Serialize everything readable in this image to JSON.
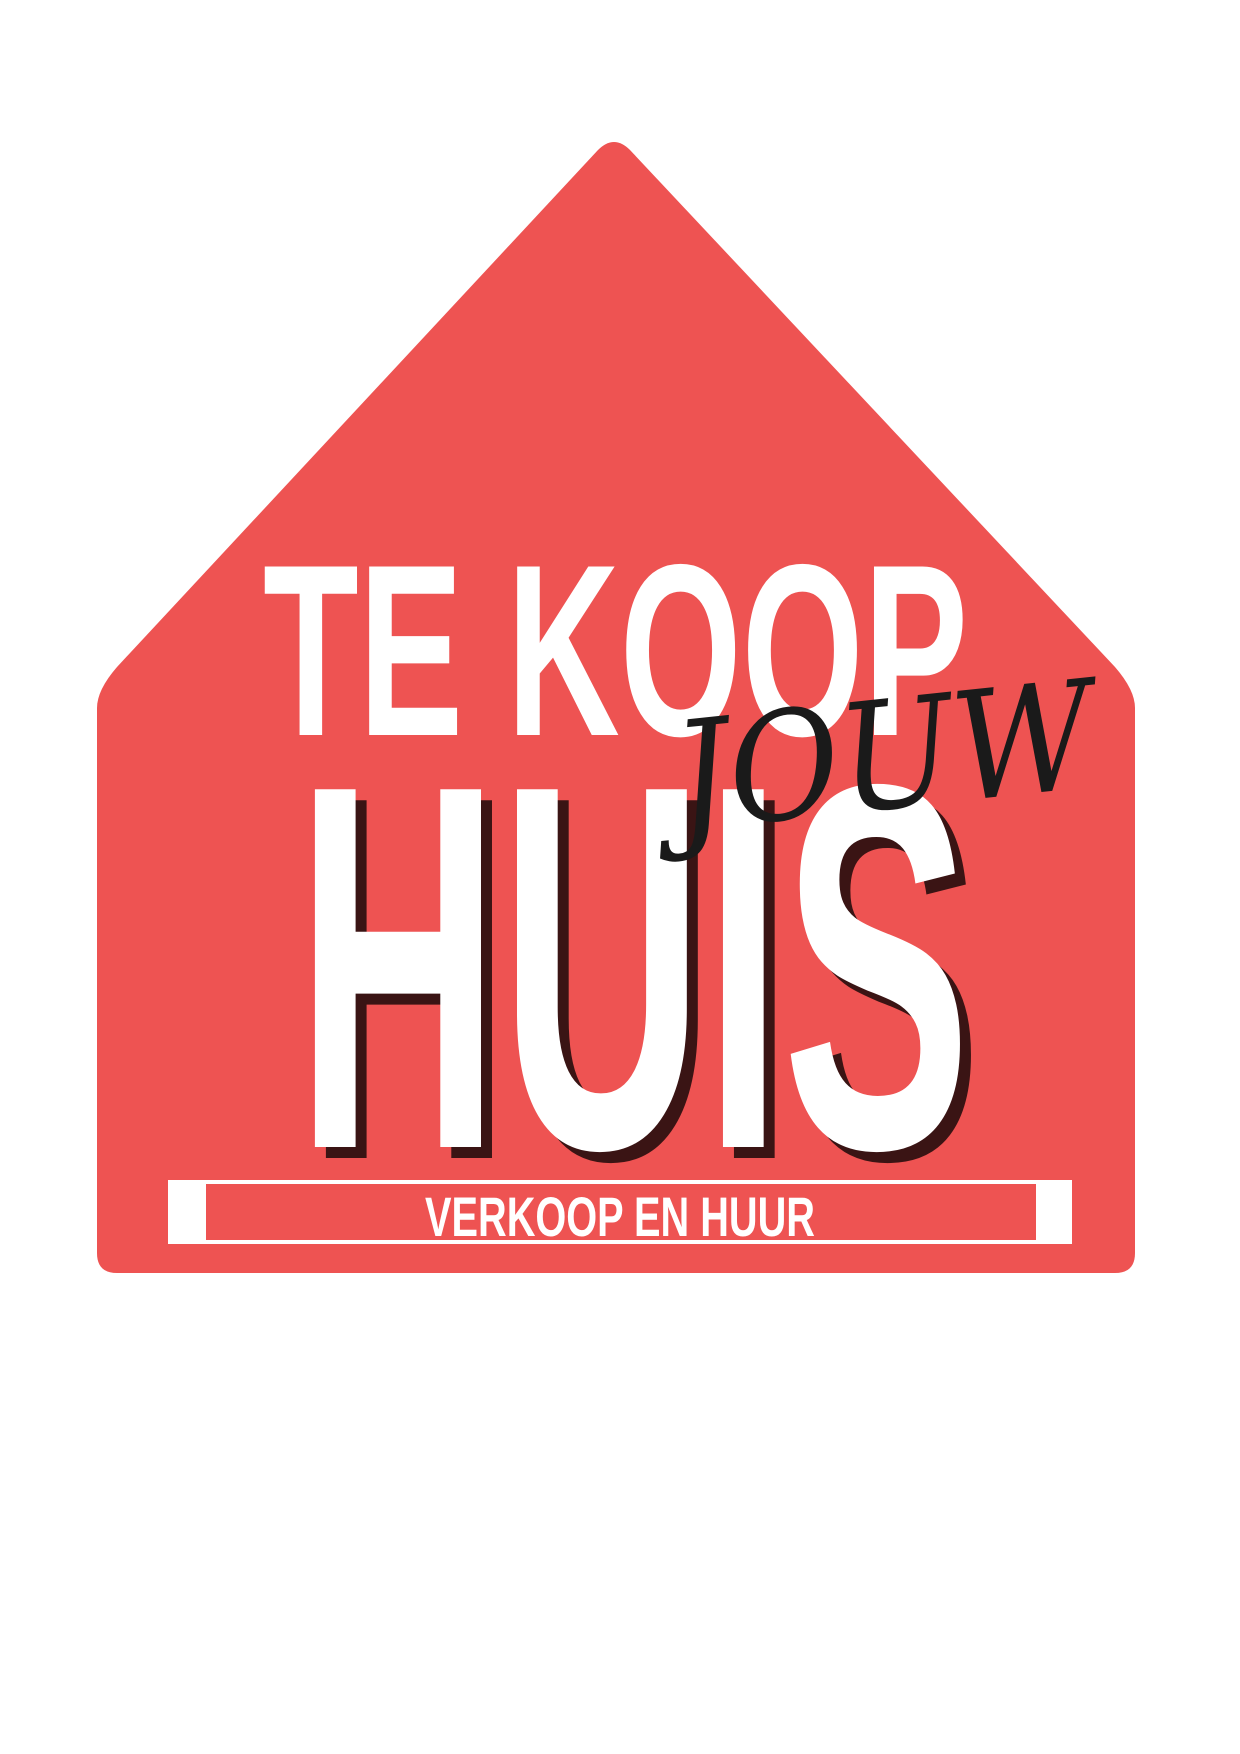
{
  "logo": {
    "line_top": "TE KOOP",
    "script_word": "JOUW",
    "main_word": "HUIS",
    "tagline": "VERKOOP EN HUUR"
  },
  "colors": {
    "house_fill": "#ee5352",
    "text_white": "#ffffff",
    "shadow_dark": "#3a1414",
    "script_ink": "#1a1a1a",
    "page_background": "#ffffff"
  }
}
